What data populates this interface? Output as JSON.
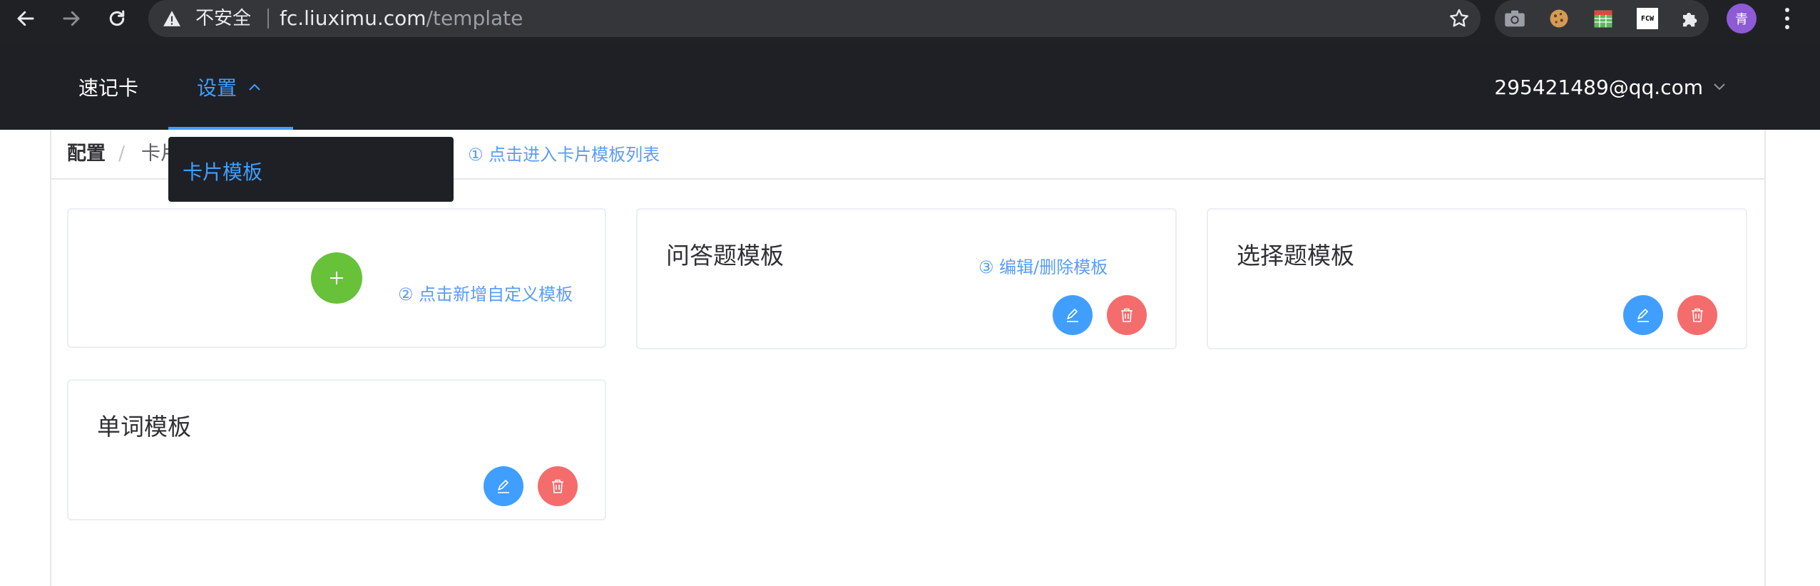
{
  "browser": {
    "security_label": "不安全",
    "url_host": "fc.liuximu.com",
    "url_path": "/template",
    "profile_initial": "青",
    "extensions": [
      "camera-icon",
      "cookie-icon",
      "calendar-sheet-icon",
      "fcw-icon",
      "puzzle-icon"
    ],
    "fcw_label": "FCW"
  },
  "nav": {
    "items": [
      {
        "label": "速记卡"
      },
      {
        "label": "设置"
      }
    ],
    "account": "295421489@qq.com",
    "dropdown": {
      "items": [
        {
          "label": "卡片模板"
        }
      ]
    }
  },
  "breadcrumb": {
    "root": "配置",
    "separator": "/",
    "current": "卡片模板"
  },
  "annotations": {
    "step1": "① 点击进入卡片模板列表",
    "step2": "② 点击新增自定义模板",
    "step3": "③ 编辑/删除模板"
  },
  "templates": [
    {
      "title": "问答题模板"
    },
    {
      "title": "选择题模板"
    },
    {
      "title": "单词模板"
    }
  ],
  "colors": {
    "accent": "#409eff",
    "add": "#67c23a",
    "danger": "#f56c6c",
    "header_bg": "#1f2025"
  }
}
